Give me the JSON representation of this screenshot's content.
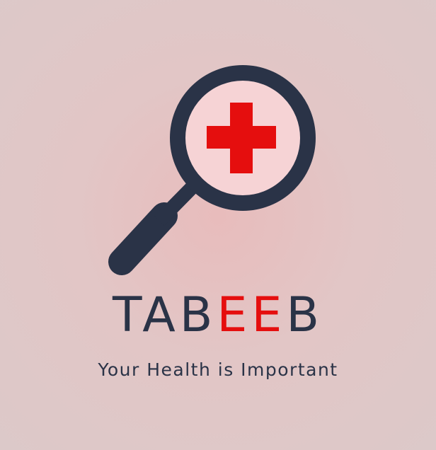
{
  "brand": {
    "name_part1": "TAB",
    "name_accent": "EE",
    "name_part2": "B",
    "tagline": "Your Health is Important"
  },
  "logo": {
    "icon": "magnifier-medical-cross-icon",
    "colors": {
      "dark": "#2a3347",
      "accent": "#e50e0e",
      "lens": "#f6d3d5",
      "background": "#e2c6c6"
    }
  }
}
